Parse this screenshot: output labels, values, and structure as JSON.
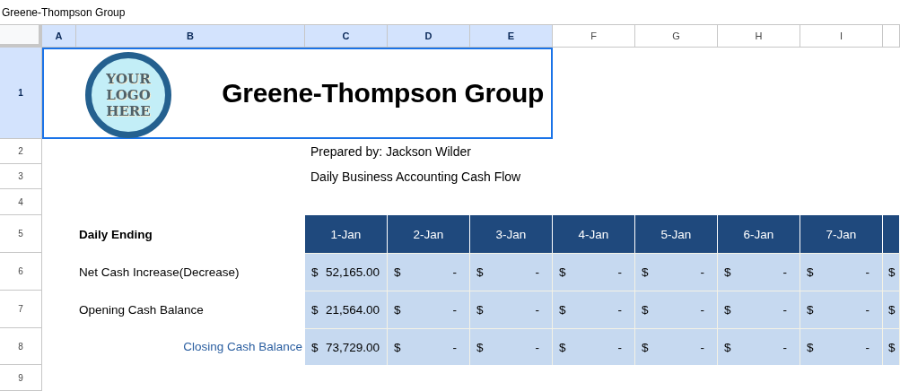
{
  "title_bar": {
    "text": "Greene-Thompson Group"
  },
  "columns": [
    {
      "label": "A",
      "selected": true
    },
    {
      "label": "B",
      "selected": true
    },
    {
      "label": "C",
      "selected": true
    },
    {
      "label": "D",
      "selected": true
    },
    {
      "label": "E",
      "selected": true
    },
    {
      "label": "F",
      "selected": false
    },
    {
      "label": "G",
      "selected": false
    },
    {
      "label": "H",
      "selected": false
    },
    {
      "label": "I",
      "selected": false
    }
  ],
  "rows": [
    {
      "label": "1",
      "selected": true
    },
    {
      "label": "2",
      "selected": false
    },
    {
      "label": "3",
      "selected": false
    },
    {
      "label": "4",
      "selected": false
    },
    {
      "label": "5",
      "selected": false
    },
    {
      "label": "6",
      "selected": false
    },
    {
      "label": "7",
      "selected": false
    },
    {
      "label": "8",
      "selected": false
    },
    {
      "label": "9",
      "selected": false
    }
  ],
  "banner": {
    "logo_text": "YOUR LOGO HERE",
    "title": "Greene-Thompson Group"
  },
  "info": [
    "Prepared by: Jackson Wilder",
    "Daily Business Accounting Cash Flow"
  ],
  "cash_table": {
    "heading": "Daily Ending",
    "dates": [
      "1-Jan",
      "2-Jan",
      "3-Jan",
      "4-Jan",
      "5-Jan",
      "6-Jan",
      "7-Jan"
    ],
    "lines": [
      {
        "label": "Net Cash Increase(Decrease)",
        "kind": "line",
        "cells": [
          {
            "symbol": "$",
            "amount": "52,165.00"
          },
          {
            "symbol": "$",
            "amount": "-"
          },
          {
            "symbol": "$",
            "amount": "-"
          },
          {
            "symbol": "$",
            "amount": "-"
          },
          {
            "symbol": "$",
            "amount": "-"
          },
          {
            "symbol": "$",
            "amount": "-"
          },
          {
            "symbol": "$",
            "amount": "-"
          },
          {
            "symbol": "$"
          }
        ]
      },
      {
        "label": "Opening Cash Balance",
        "kind": "line",
        "cells": [
          {
            "symbol": "$",
            "amount": "21,564.00"
          },
          {
            "symbol": "$",
            "amount": "-"
          },
          {
            "symbol": "$",
            "amount": "-"
          },
          {
            "symbol": "$",
            "amount": "-"
          },
          {
            "symbol": "$",
            "amount": "-"
          },
          {
            "symbol": "$",
            "amount": "-"
          },
          {
            "symbol": "$",
            "amount": "-"
          },
          {
            "symbol": "$"
          }
        ]
      },
      {
        "label": "Closing Cash Balance",
        "kind": "total",
        "cells": [
          {
            "symbol": "$",
            "amount": "73,729.00"
          },
          {
            "symbol": "$",
            "amount": "-"
          },
          {
            "symbol": "$",
            "amount": "-"
          },
          {
            "symbol": "$",
            "amount": "-"
          },
          {
            "symbol": "$",
            "amount": "-"
          },
          {
            "symbol": "$",
            "amount": "-"
          },
          {
            "symbol": "$",
            "amount": "-"
          },
          {
            "symbol": "$"
          }
        ]
      }
    ]
  }
}
